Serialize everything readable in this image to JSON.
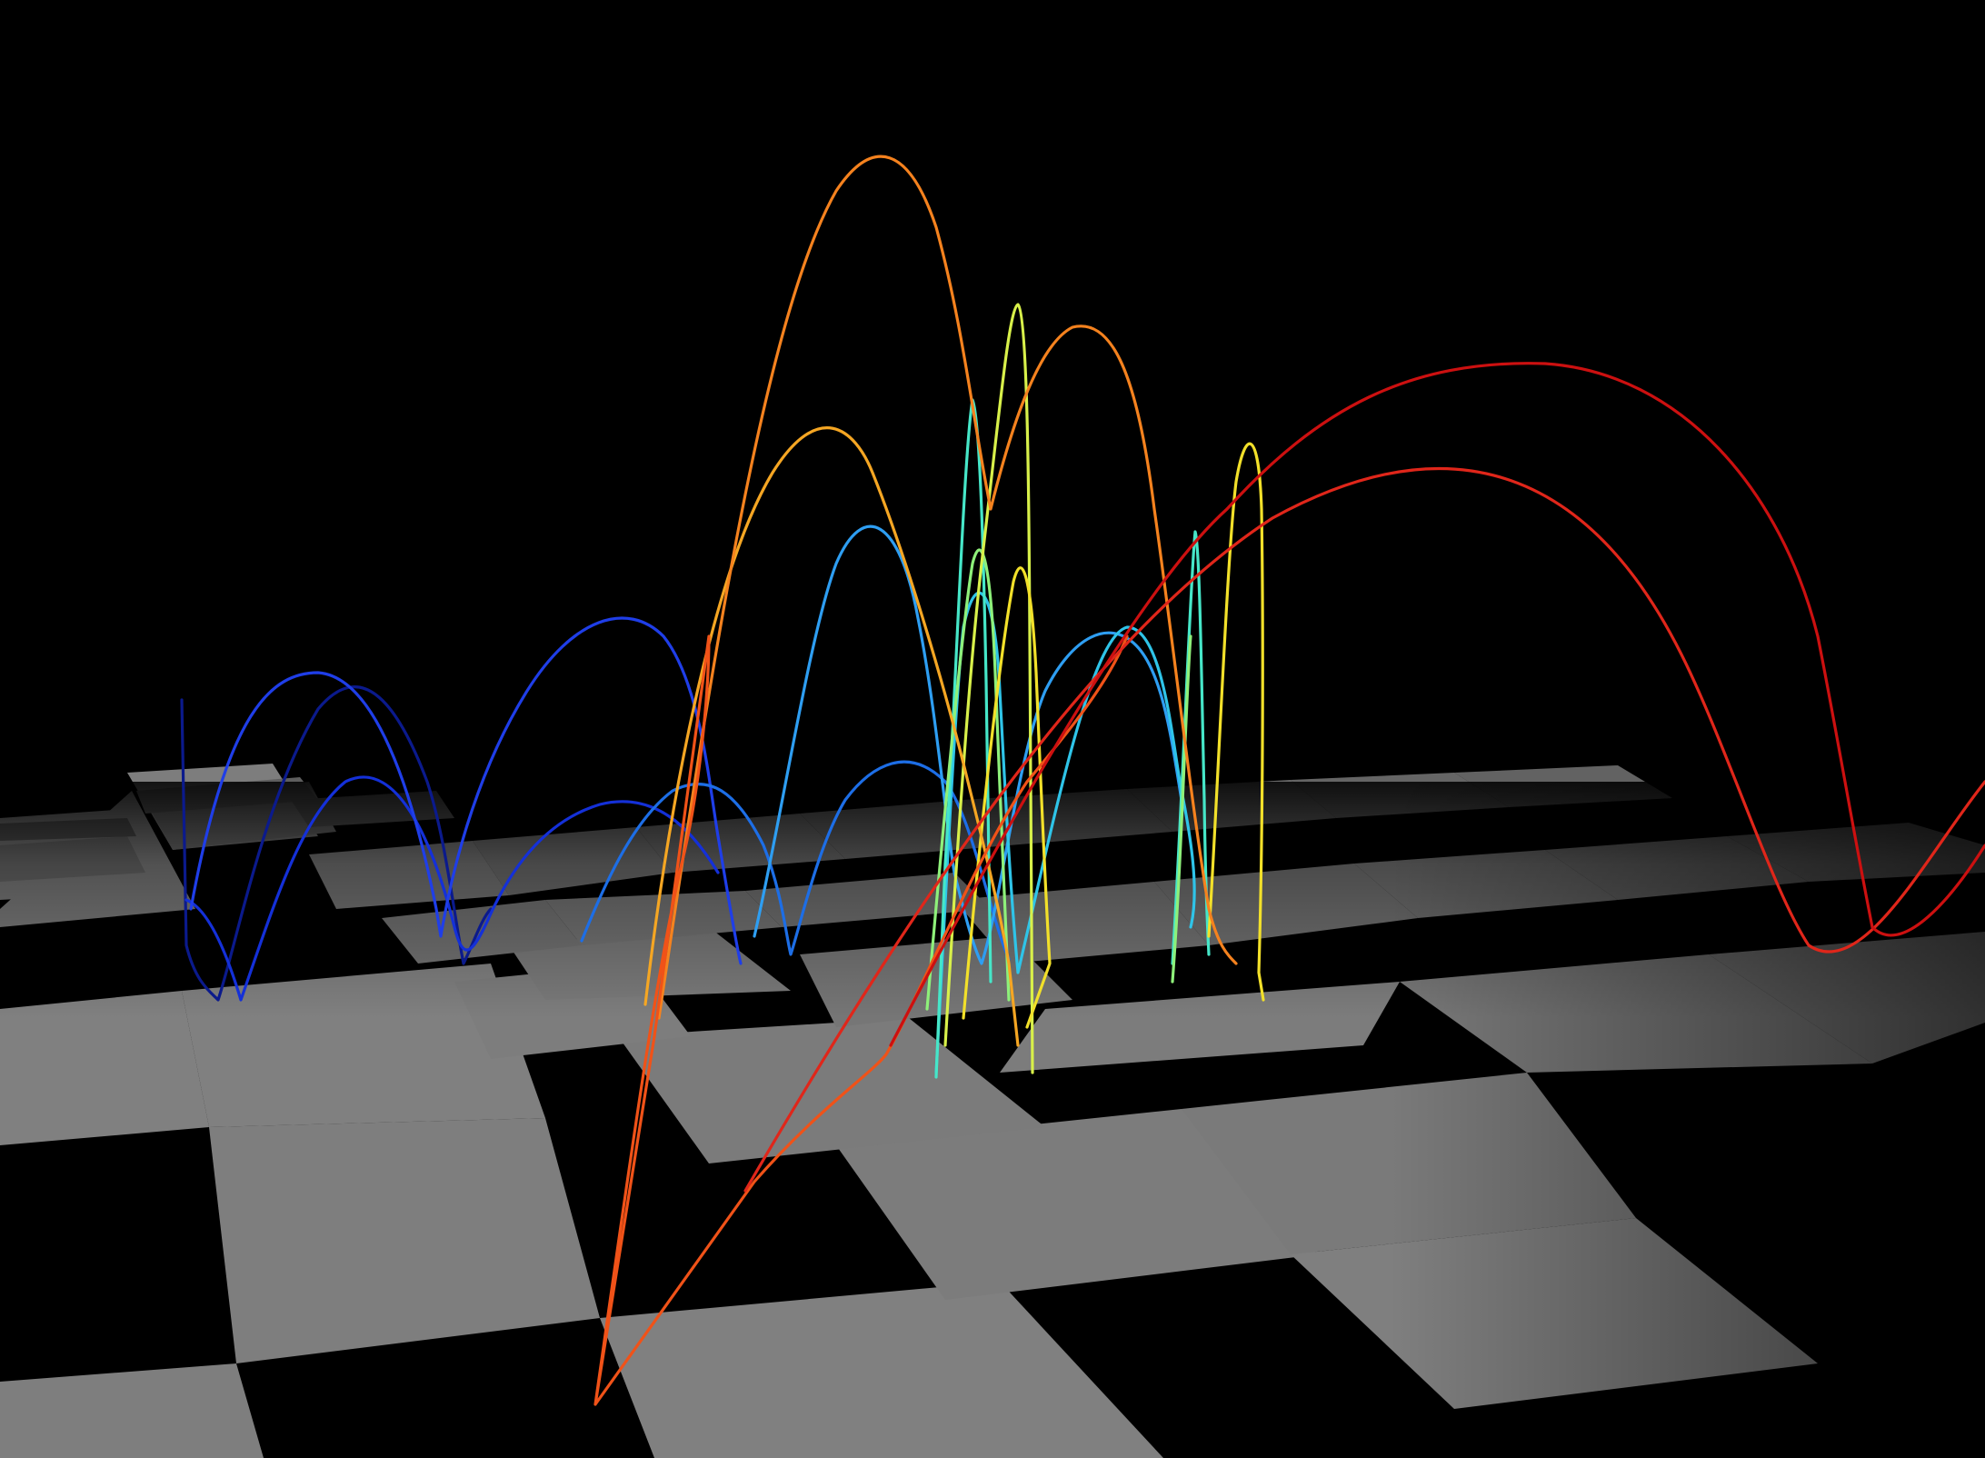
{
  "scene": {
    "background": "#000000",
    "floor": {
      "light_color": "#8a8a8a",
      "dark_color": "#050505",
      "pattern": "checkerboard"
    },
    "colormap": "jet"
  },
  "trajectories": [
    {
      "id": "t1",
      "color": "#0b1a8c"
    },
    {
      "id": "t2",
      "color": "#1430d8"
    },
    {
      "id": "t3",
      "color": "#1f3ee8"
    },
    {
      "id": "t4",
      "color": "#1d6ee6"
    },
    {
      "id": "t5",
      "color": "#2e9ef2"
    },
    {
      "id": "t6",
      "color": "#2fc4e8"
    },
    {
      "id": "t7",
      "color": "#46e6c8"
    },
    {
      "id": "t8",
      "color": "#8ef07a"
    },
    {
      "id": "t9",
      "color": "#d8f04a"
    },
    {
      "id": "t10",
      "color": "#f2e02a"
    },
    {
      "id": "t11",
      "color": "#f5a623"
    },
    {
      "id": "t12",
      "color": "#f5821e"
    },
    {
      "id": "t13",
      "color": "#f05218"
    },
    {
      "id": "t14",
      "color": "#e0261a"
    },
    {
      "id": "t15",
      "color": "#cc1010"
    }
  ]
}
